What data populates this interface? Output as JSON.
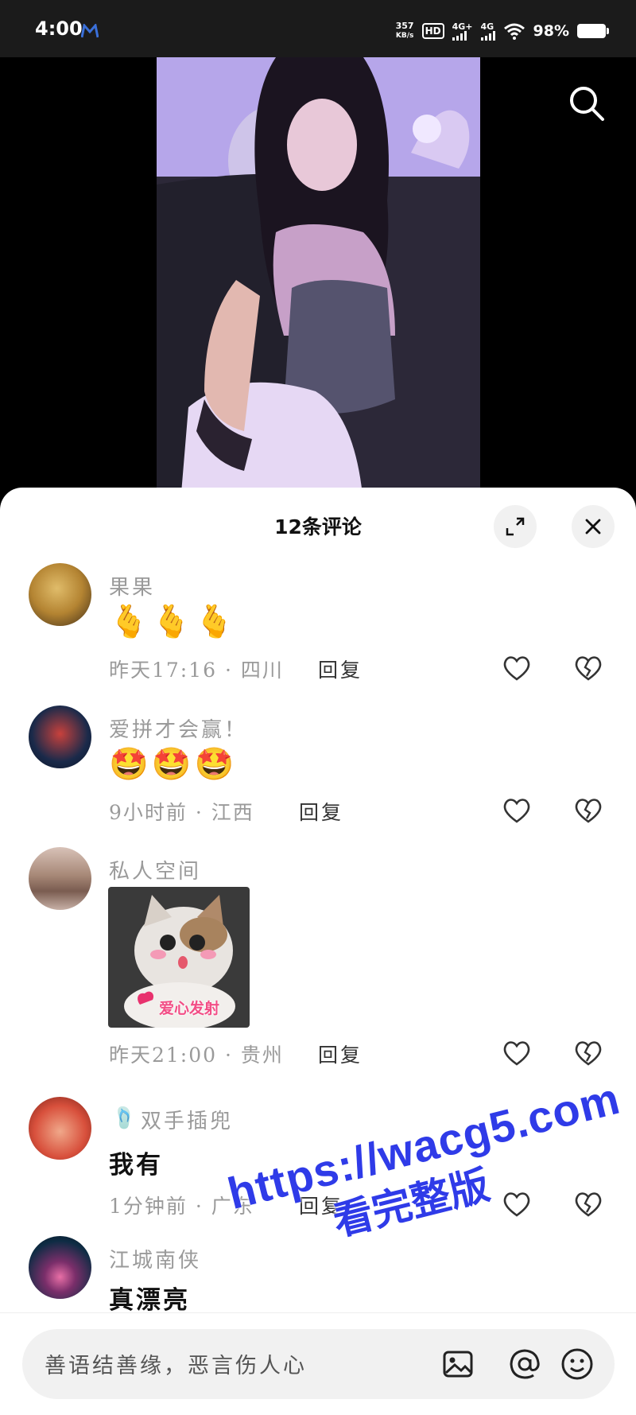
{
  "status_bar": {
    "time": "4:00",
    "net_speed": "357",
    "net_unit": "KB/s",
    "hd_label": "HD",
    "sig1": "4G+",
    "sig2": "4G",
    "battery": "98%"
  },
  "sheet": {
    "title": "12条评论",
    "expand_icon": "expand-icon",
    "close_icon": "close-icon"
  },
  "comments": [
    {
      "user": "果果",
      "emoji": "🫰🫰🫰",
      "time": "昨天17:16 · 四川",
      "reply": "回复",
      "avatar_color": "#c89a48"
    },
    {
      "user": "爱拼才会赢！",
      "emoji": "🤩🤩🤩",
      "time": "9小时前 · 江西",
      "reply": "回复",
      "avatar_color": "#1a2a4a"
    },
    {
      "user": "私人空间",
      "sticker_text": "爱心发射",
      "time": "昨天21:00 · 贵州",
      "reply": "回复",
      "avatar_color": "#a78877"
    },
    {
      "user_icon": "🩴",
      "user": "双手插兜",
      "text": "我有",
      "time": "1分钟前 · 广东",
      "reply": "回复",
      "avatar_color": "#d8503c"
    },
    {
      "user": "江城南侠",
      "text": "真漂亮",
      "avatar_color": "#0e2c44"
    }
  ],
  "input": {
    "placeholder": "善语结善缘，恶言伤人心",
    "icons": [
      "image-icon",
      "at-icon",
      "emoji-icon"
    ]
  },
  "watermark": {
    "line1": "https://wacg5.com",
    "line2": "看完整版"
  },
  "colors": {
    "accent": "#2f3be8",
    "muted": "#9a9a9a"
  }
}
